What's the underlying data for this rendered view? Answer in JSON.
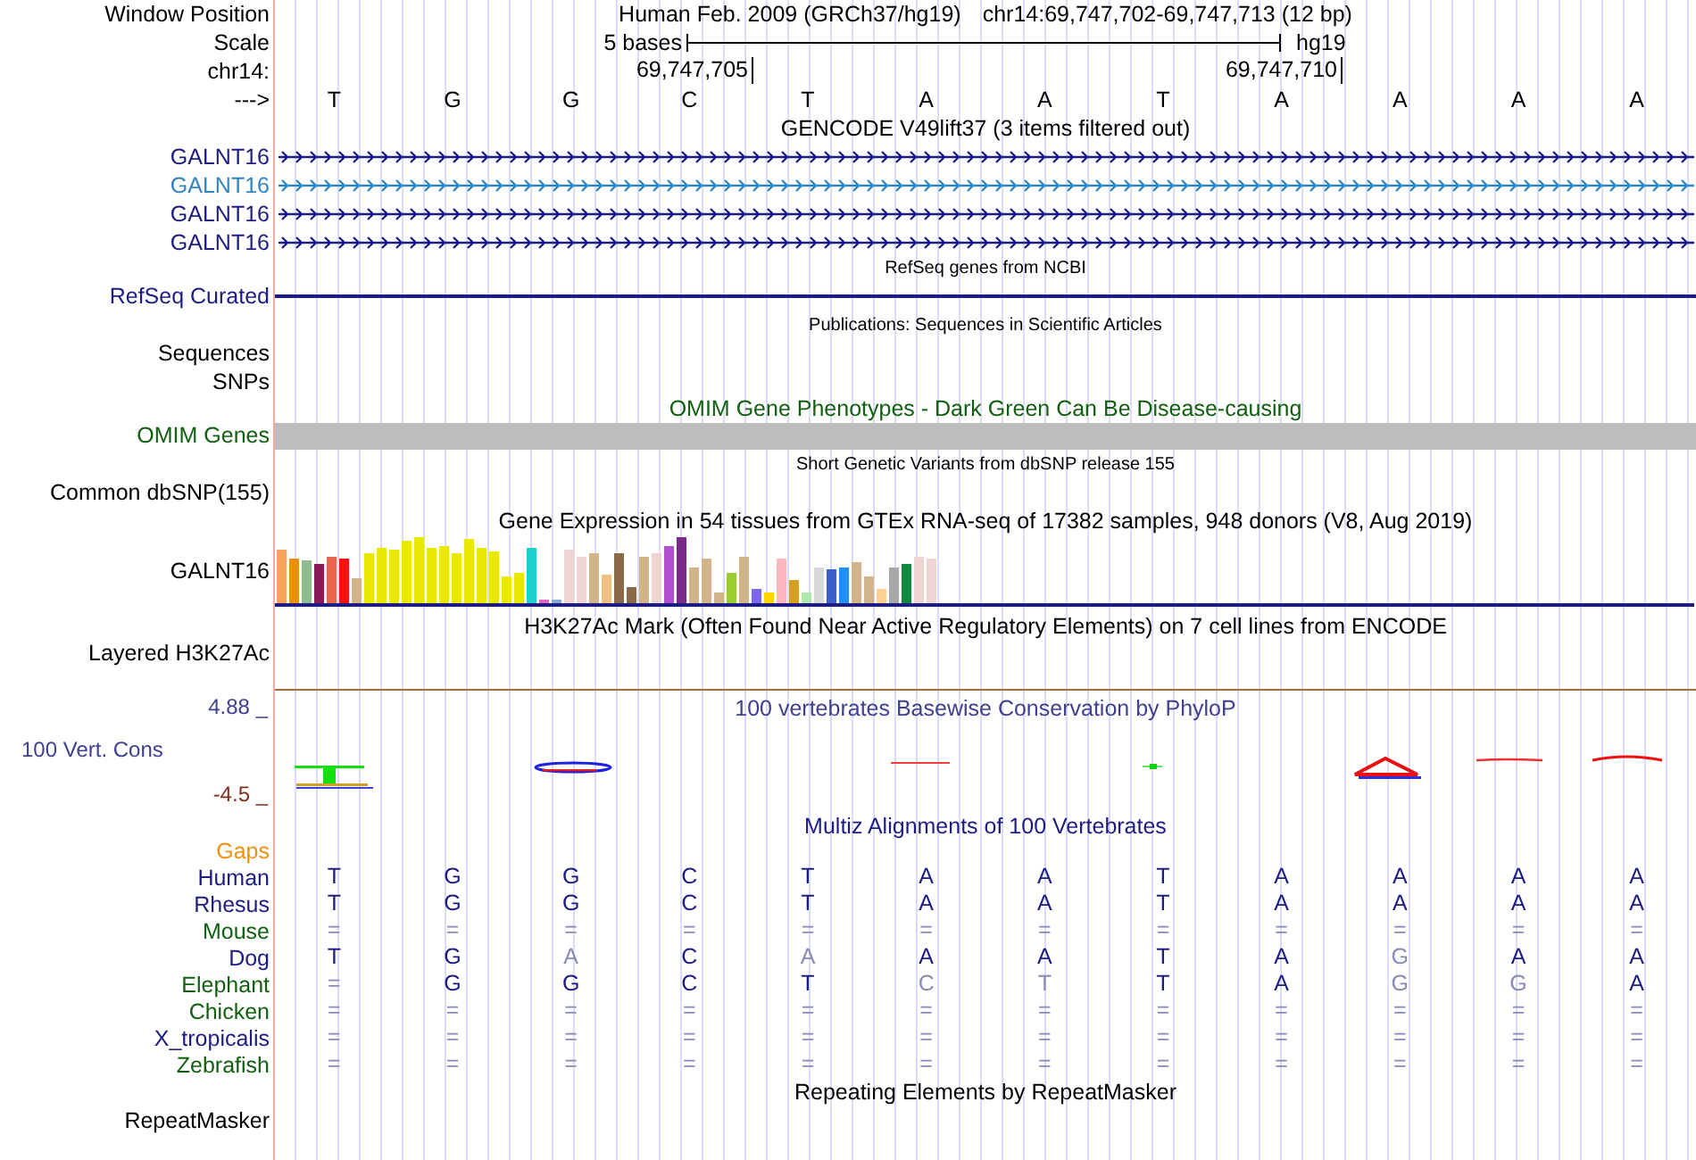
{
  "position": {
    "label": "Window Position",
    "assembly": "Human Feb. 2009 (GRCh37/hg19)",
    "range": "chr14:69,747,702-69,747,713 (12 bp)"
  },
  "scale": {
    "label": "Scale",
    "length": "5 bases",
    "assembly": "hg19"
  },
  "ruler": {
    "label": "chr14:",
    "ticks": [
      "69,747,705",
      "69,747,710"
    ]
  },
  "strand": {
    "label": "--->",
    "bases": [
      "T",
      "G",
      "G",
      "C",
      "T",
      "A",
      "A",
      "T",
      "A",
      "A",
      "A",
      "A"
    ]
  },
  "gencode": {
    "title": "GENCODE V49lift37 (3 items filtered out)",
    "items": [
      {
        "label": "GALNT16",
        "color": "#1c1c82"
      },
      {
        "label": "GALNT16",
        "color": "#2f86c0"
      },
      {
        "label": "GALNT16",
        "color": "#1c1c82"
      },
      {
        "label": "GALNT16",
        "color": "#1c1c82"
      }
    ]
  },
  "refseq": {
    "title": "RefSeq genes from NCBI",
    "label": "RefSeq Curated"
  },
  "publications": {
    "title": "Publications: Sequences in Scientific Articles",
    "labels": [
      "Sequences",
      "SNPs"
    ]
  },
  "omim": {
    "title": "OMIM Gene Phenotypes - Dark Green Can Be Disease-causing",
    "label": "OMIM Genes"
  },
  "dbsnp": {
    "title": "Short Genetic Variants from dbSNP release 155",
    "label": "Common dbSNP(155)"
  },
  "gtex": {
    "title": "Gene Expression in 54 tissues from GTEx RNA-seq of 17382 samples, 948 donors (V8, Aug 2019)",
    "label": "GALNT16"
  },
  "h3k27ac": {
    "title": "H3K27Ac Mark (Often Found Near Active Regulatory Elements) on 7 cell lines from ENCODE",
    "label": "Layered H3K27Ac"
  },
  "conservation": {
    "title": "100 vertebrates Basewise Conservation by PhyloP",
    "label": "100 Vert. Cons",
    "max": "4.88 _",
    "min": "-4.5 _"
  },
  "multiz": {
    "title": "Multiz Alignments of 100 Vertebrates",
    "gaps_label": "Gaps",
    "species": [
      {
        "name": "Human",
        "color": "#1c1c82",
        "bases": [
          "T",
          "G",
          "G",
          "C",
          "T",
          "A",
          "A",
          "T",
          "A",
          "A",
          "A",
          "A"
        ]
      },
      {
        "name": "Rhesus",
        "color": "#1c1c82",
        "bases": [
          "T",
          "G",
          "G",
          "C",
          "T",
          "A",
          "A",
          "T",
          "A",
          "A",
          "A",
          "A"
        ]
      },
      {
        "name": "Mouse",
        "color": "#106010",
        "bases": [
          "=",
          "=",
          "=",
          "=",
          "=",
          "=",
          "=",
          "=",
          "=",
          "=",
          "=",
          "="
        ]
      },
      {
        "name": "Dog",
        "color": "#1c1c82",
        "bases": [
          "T",
          "G",
          "A",
          "C",
          "A",
          "A",
          "A",
          "T",
          "A",
          "G",
          "A",
          "A"
        ]
      },
      {
        "name": "Elephant",
        "color": "#106010",
        "bases": [
          "=",
          "G",
          "G",
          "C",
          "T",
          "C",
          "T",
          "T",
          "A",
          "G",
          "G",
          "A"
        ]
      },
      {
        "name": "Chicken",
        "color": "#106010",
        "bases": [
          "=",
          "=",
          "=",
          "=",
          "=",
          "=",
          "=",
          "=",
          "=",
          "=",
          "=",
          "="
        ]
      },
      {
        "name": "X_tropicalis",
        "color": "#1c1c82",
        "bases": [
          "=",
          "=",
          "=",
          "=",
          "=",
          "=",
          "=",
          "=",
          "=",
          "=",
          "=",
          "="
        ]
      },
      {
        "name": "Zebrafish",
        "color": "#106010",
        "bases": [
          "=",
          "=",
          "=",
          "=",
          "=",
          "=",
          "=",
          "=",
          "=",
          "=",
          "=",
          "="
        ]
      }
    ]
  },
  "repeatmasker": {
    "title": "Repeating Elements by RepeatMasker",
    "label": "RepeatMasker"
  }
}
